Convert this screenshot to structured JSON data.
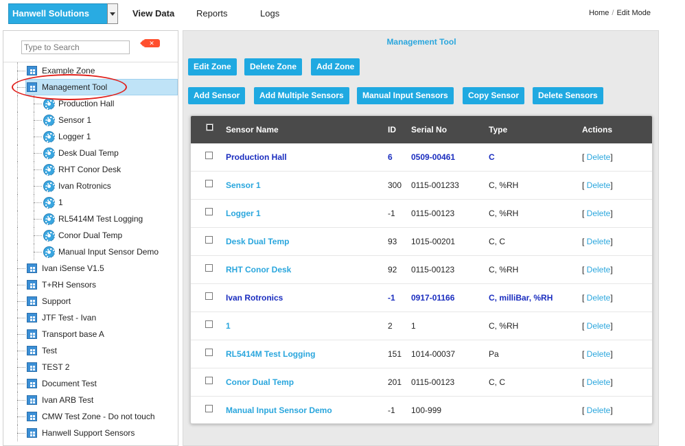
{
  "header": {
    "company": "Hanwell Solutions",
    "nav": [
      "View Data",
      "Reports",
      "Logs"
    ],
    "breadcrumb": [
      "Home",
      "Edit Mode"
    ]
  },
  "sidebar": {
    "search_placeholder": "Type to Search",
    "clear_label": "✕",
    "tree": [
      {
        "label": "Example Zone",
        "type": "zone",
        "level": 0
      },
      {
        "label": "Management Tool",
        "type": "zone",
        "level": 0,
        "selected": true
      },
      {
        "label": "Production Hall",
        "type": "sensor",
        "level": 1
      },
      {
        "label": "Sensor 1",
        "type": "sensor",
        "level": 1
      },
      {
        "label": "Logger 1",
        "type": "sensor",
        "level": 1
      },
      {
        "label": "Desk Dual Temp",
        "type": "sensor",
        "level": 1
      },
      {
        "label": "RHT Conor Desk",
        "type": "sensor",
        "level": 1
      },
      {
        "label": "Ivan Rotronics",
        "type": "sensor",
        "level": 1
      },
      {
        "label": "1",
        "type": "sensor",
        "level": 1
      },
      {
        "label": "RL5414M Test Logging",
        "type": "sensor",
        "level": 1
      },
      {
        "label": "Conor Dual Temp",
        "type": "sensor",
        "level": 1
      },
      {
        "label": "Manual Input Sensor Demo",
        "type": "sensor",
        "level": 1
      },
      {
        "label": "Ivan iSense V1.5",
        "type": "zone",
        "level": 0
      },
      {
        "label": "T+RH Sensors",
        "type": "zone",
        "level": 0
      },
      {
        "label": "Support",
        "type": "zone",
        "level": 0
      },
      {
        "label": "JTF Test - Ivan",
        "type": "zone",
        "level": 0
      },
      {
        "label": "Transport base A",
        "type": "zone",
        "level": 0
      },
      {
        "label": "Test",
        "type": "zone",
        "level": 0
      },
      {
        "label": "TEST 2",
        "type": "zone",
        "level": 0
      },
      {
        "label": "Document Test",
        "type": "zone",
        "level": 0
      },
      {
        "label": "Ivan ARB Test",
        "type": "zone",
        "level": 0
      },
      {
        "label": "CMW Test Zone - Do not touch",
        "type": "zone",
        "level": 0
      },
      {
        "label": "Hanwell Support Sensors",
        "type": "zone",
        "level": 0
      }
    ]
  },
  "main": {
    "title": "Management Tool",
    "zone_buttons": [
      "Edit Zone",
      "Delete Zone",
      "Add Zone"
    ],
    "sensor_buttons": [
      "Add Sensor",
      "Add Multiple Sensors",
      "Manual Input Sensors",
      "Copy Sensor",
      "Delete Sensors"
    ],
    "table": {
      "columns": [
        "Sensor Name",
        "ID",
        "Serial No",
        "Type",
        "Actions"
      ],
      "action_label": "Delete",
      "rows": [
        {
          "name": "Production Hall",
          "id": "6",
          "serial": "0509-00461",
          "type": "C",
          "highlight": true
        },
        {
          "name": "Sensor 1",
          "id": "300",
          "serial": "0115-001233",
          "type": "C, %RH",
          "highlight": false
        },
        {
          "name": "Logger 1",
          "id": "-1",
          "serial": "0115-00123",
          "type": "C, %RH",
          "highlight": false
        },
        {
          "name": "Desk Dual Temp",
          "id": "93",
          "serial": "1015-00201",
          "type": "C, C",
          "highlight": false
        },
        {
          "name": "RHT Conor Desk",
          "id": "92",
          "serial": "0115-00123",
          "type": "C, %RH",
          "highlight": false
        },
        {
          "name": "Ivan Rotronics",
          "id": "-1",
          "serial": "0917-01166",
          "type": "C, milliBar, %RH",
          "highlight": true
        },
        {
          "name": "1",
          "id": "2",
          "serial": "1",
          "type": "C, %RH",
          "highlight": false
        },
        {
          "name": "RL5414M Test Logging",
          "id": "151",
          "serial": "1014-00037",
          "type": "Pa",
          "highlight": false
        },
        {
          "name": "Conor Dual Temp",
          "id": "201",
          "serial": "0115-00123",
          "type": "C, C",
          "highlight": false
        },
        {
          "name": "Manual Input Sensor Demo",
          "id": "-1",
          "serial": "100-999",
          "type": "",
          "highlight": false
        }
      ]
    }
  },
  "colors": {
    "accent": "#1fa9e1",
    "link": "#2aa6dd",
    "highlight_text": "#1a2dbf",
    "table_header": "#4a4a4a",
    "annotation": "#e0201b"
  }
}
